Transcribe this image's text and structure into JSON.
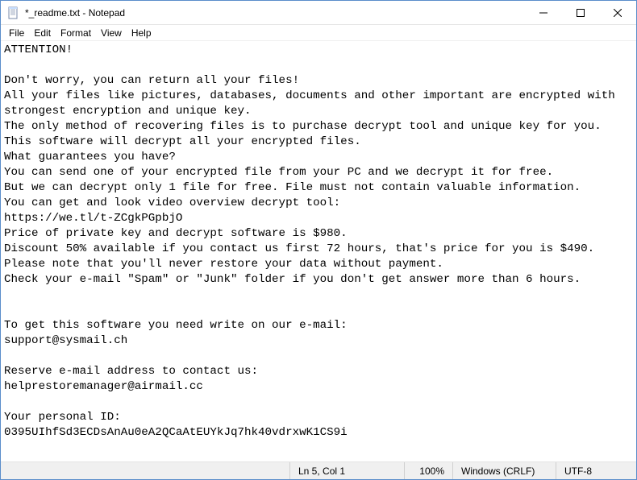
{
  "window": {
    "title": "*_readme.txt - Notepad"
  },
  "menu": {
    "file": "File",
    "edit": "Edit",
    "format": "Format",
    "view": "View",
    "help": "Help"
  },
  "content": {
    "text": "ATTENTION!\n\nDon't worry, you can return all your files!\nAll your files like pictures, databases, documents and other important are encrypted with strongest encryption and unique key.\nThe only method of recovering files is to purchase decrypt tool and unique key for you.\nThis software will decrypt all your encrypted files.\nWhat guarantees you have?\nYou can send one of your encrypted file from your PC and we decrypt it for free.\nBut we can decrypt only 1 file for free. File must not contain valuable information.\nYou can get and look video overview decrypt tool:\nhttps://we.tl/t-ZCgkPGpbjO\nPrice of private key and decrypt software is $980.\nDiscount 50% available if you contact us first 72 hours, that's price for you is $490.\nPlease note that you'll never restore your data without payment.\nCheck your e-mail \"Spam\" or \"Junk\" folder if you don't get answer more than 6 hours.\n\n\nTo get this software you need write on our e-mail:\nsupport@sysmail.ch\n\nReserve e-mail address to contact us:\nhelprestoremanager@airmail.cc\n\nYour personal ID:\n0395UIhfSd3ECDsAnAu0eA2QCaAtEUYkJq7hk40vdrxwK1CS9i"
  },
  "statusbar": {
    "position": "Ln 5, Col 1",
    "zoom": "100%",
    "line_ending": "Windows (CRLF)",
    "encoding": "UTF-8"
  }
}
